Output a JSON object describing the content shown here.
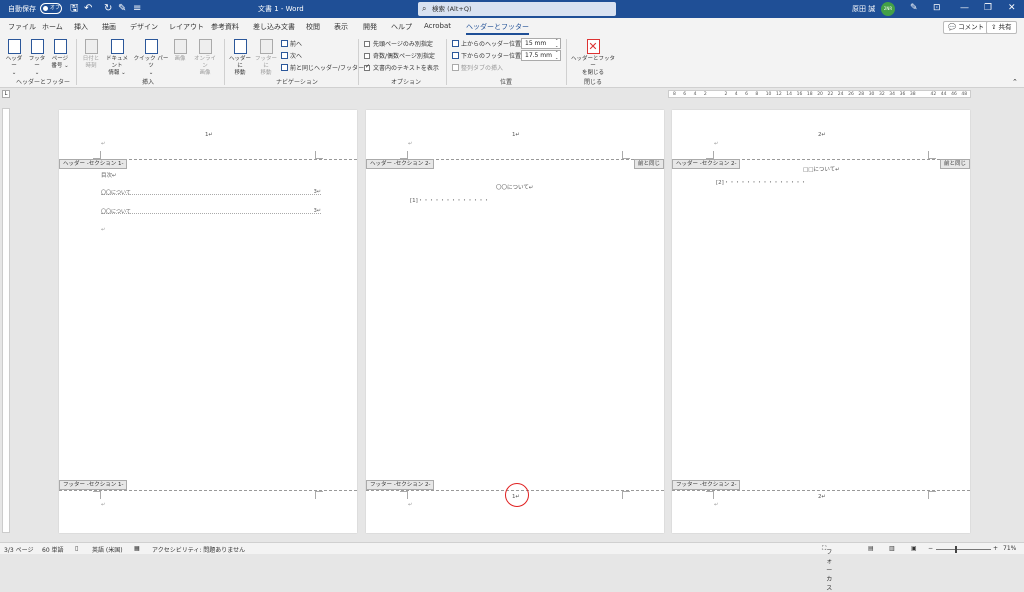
{
  "titlebar": {
    "autosave": "自動保存",
    "autosave_state": "オフ",
    "doc_title": "文書 1 - Word",
    "search": "検索 (Alt+Q)",
    "user": "原田 誠",
    "avatar": "2NR"
  },
  "tabs": [
    "ファイル",
    "ホーム",
    "挿入",
    "描画",
    "デザイン",
    "レイアウト",
    "参考資料",
    "差し込み文書",
    "校閲",
    "表示",
    "開発",
    "ヘルプ",
    "Acrobat",
    "ヘッダーとフッター"
  ],
  "comment_btn": "コメント",
  "share_btn": "共有",
  "ribbon": {
    "header": "ヘッダー",
    "footer": "フッター",
    "page_number": [
      "ページ",
      "番号"
    ],
    "group_hf": "ヘッダーとフッター",
    "date_time": [
      "日付と",
      "時刻"
    ],
    "doc_info": [
      "ドキュメント",
      "情報"
    ],
    "quick_parts": [
      "クイック パーツ"
    ],
    "picture": "画像",
    "online_picture": [
      "オンライン",
      "画像"
    ],
    "group_insert": "挿入",
    "goto_header": [
      "ヘッダーに",
      "移動"
    ],
    "goto_footer": [
      "フッターに",
      "移動"
    ],
    "prev": "前へ",
    "next": "次へ",
    "link_prev": "前と同じヘッダー/フッター",
    "group_nav": "ナビゲーション",
    "opt_first": "先頭ページのみ別指定",
    "opt_oddeven": "奇数/偶数ページ別指定",
    "opt_showtext": "文書内のテキストを表示",
    "group_options": "オプション",
    "header_pos_label": "上からのヘッダー位置:",
    "header_pos": "15 mm",
    "footer_pos_label": "下からのフッター位置:",
    "footer_pos": "17.5 mm",
    "insert_align_tab": "整列タブの挿入",
    "group_position": "位置",
    "close": [
      "ヘッダーとフッター",
      "を閉じる"
    ],
    "group_close": "閉じる"
  },
  "ruler_ticks": [
    "8",
    "6",
    "4",
    "2",
    "",
    "2",
    "4",
    "6",
    "8",
    "10",
    "12",
    "14",
    "16",
    "18",
    "20",
    "22",
    "24",
    "26",
    "28",
    "30",
    "32",
    "34",
    "36",
    "38",
    "",
    "42",
    "44",
    "46",
    "48"
  ],
  "pages": [
    {
      "hdr_tag": "ヘッダー -セクション 1-",
      "ftr_tag": "フッター -セクション 1-",
      "hdr_num": "1↵",
      "ftr_num": "",
      "same": "",
      "toc_title": "目次↵",
      "toc": [
        {
          "t": "〇〇について",
          "p": "3↵"
        },
        {
          "t": "〇〇について",
          "p": "3↵"
        }
      ],
      "heading": "",
      "item": ""
    },
    {
      "hdr_tag": "ヘッダー -セクション 2-",
      "ftr_tag": "フッター -セクション 2-",
      "hdr_num": "1↵",
      "ftr_num": "1↵",
      "same": "前と同じ",
      "toc_title": "",
      "toc": [],
      "heading": "〇〇について↵",
      "item": "[1]・・・・・・・・・・・・・"
    },
    {
      "hdr_tag": "ヘッダー -セクション 2-",
      "ftr_tag": "フッター -セクション 2-",
      "hdr_num": "2↵",
      "ftr_num": "2↵",
      "same": "前と同じ",
      "toc_title": "",
      "toc": [],
      "heading": "□□について↵",
      "item": "[2]・・・・・・・・・・・・・・・"
    }
  ],
  "status": {
    "page": "3/3 ページ",
    "words": "60 単語",
    "lang": "英語 (米国)",
    "access": "アクセシビリティ: 問題ありません",
    "focus": "フォーカス",
    "zoom": "71%"
  }
}
